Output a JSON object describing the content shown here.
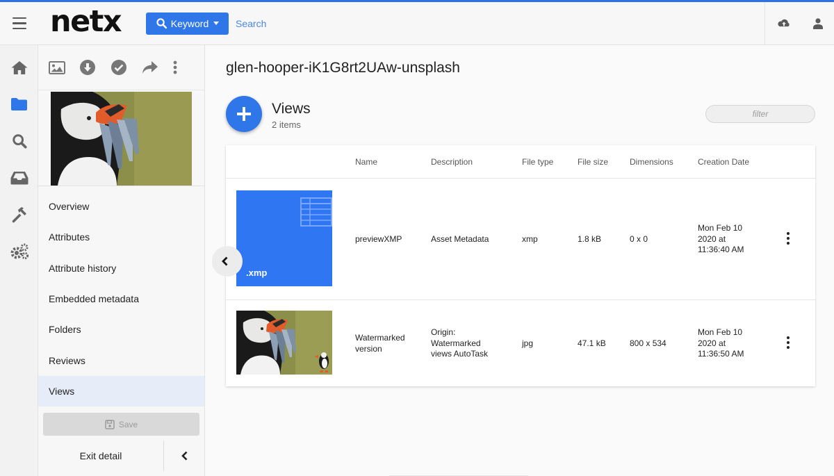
{
  "app": {
    "logo": "netx",
    "accent_color": "#2f77e8"
  },
  "topbar": {
    "search_mode_label": "Keyword",
    "search_placeholder": "Search",
    "right_icons": [
      "upload-cloud-icon",
      "user-icon"
    ]
  },
  "rail": {
    "icons": [
      "home-icon",
      "folder-icon",
      "search-icon",
      "inbox-icon",
      "hammer-icon",
      "gears-icon"
    ],
    "active_index": 1
  },
  "detail_panel": {
    "tool_icons": [
      "image-icon",
      "download-icon",
      "check-circle-icon",
      "share-icon",
      "more-vertical-icon"
    ],
    "nav": [
      {
        "label": "Overview"
      },
      {
        "label": "Attributes"
      },
      {
        "label": "Attribute history"
      },
      {
        "label": "Embedded metadata"
      },
      {
        "label": "Folders"
      },
      {
        "label": "Reviews"
      },
      {
        "label": "Views",
        "active": true
      }
    ],
    "save_label": "Save",
    "exit_label": "Exit detail"
  },
  "main": {
    "asset_title": "glen-hooper-iK1G8rt2UAw-unsplash",
    "section_title": "Views",
    "item_count": "2 items",
    "filter_placeholder": "filter",
    "table": {
      "columns": [
        "Name",
        "Description",
        "File type",
        "File size",
        "Dimensions",
        "Creation Date"
      ],
      "rows": [
        {
          "thumb_type": "xmp",
          "thumb_label": ".xmp",
          "name": [
            "previewXMP"
          ],
          "description": [
            "Asset Metadata"
          ],
          "file_type": "xmp",
          "file_size": "1.8 kB",
          "dimensions": "0 x 0",
          "created": [
            "Mon Feb 10",
            "2020 at",
            "11:36:40 AM"
          ]
        },
        {
          "thumb_type": "image",
          "thumb_label": "",
          "name": [
            "Watermarked",
            "version"
          ],
          "description": [
            "Origin:",
            "Watermarked",
            "views AutoTask"
          ],
          "file_type": "jpg",
          "file_size": "47.1 kB",
          "dimensions": "800 x 534",
          "created": [
            "Mon Feb 10",
            "2020 at",
            "11:36:50 AM"
          ]
        }
      ]
    }
  }
}
